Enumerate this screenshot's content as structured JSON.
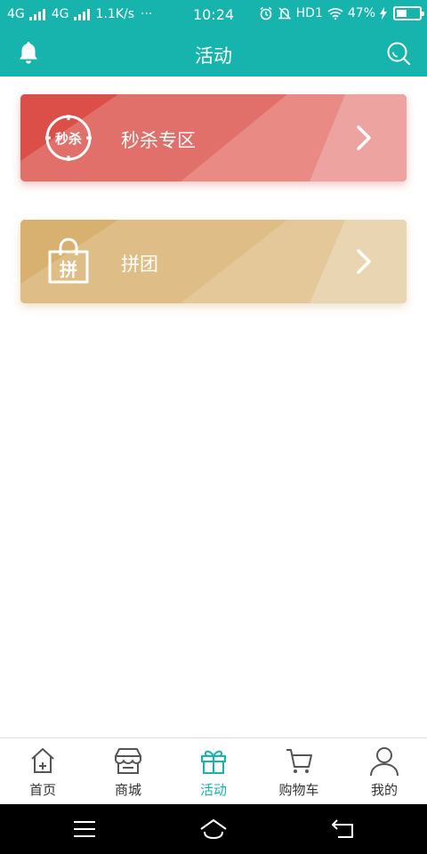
{
  "status_bar": {
    "net1": "4G",
    "net2": "4G",
    "speed": "1.1K/s",
    "more": "···",
    "time": "10:24",
    "hd": "HD1",
    "battery_percent": "47%",
    "battery_level": 0.47
  },
  "header": {
    "title": "活动",
    "left_icon": "bell-icon",
    "right_icon": "search-icon",
    "background": "#17b4ad"
  },
  "cards": [
    {
      "icon_text": "秒杀",
      "label": "秒杀专区",
      "color": "#e2706a",
      "icon": "seckill-clock-icon"
    },
    {
      "icon_text": "拼",
      "label": "拼团",
      "color": "#dfbd86",
      "icon": "shopping-bag-icon"
    }
  ],
  "tabs": [
    {
      "label": "首页",
      "icon": "home-icon",
      "active": false
    },
    {
      "label": "商城",
      "icon": "store-icon",
      "active": false
    },
    {
      "label": "活动",
      "icon": "gift-icon",
      "active": true
    },
    {
      "label": "购物车",
      "icon": "cart-icon",
      "active": false
    },
    {
      "label": "我的",
      "icon": "user-icon",
      "active": false
    }
  ],
  "accent_color": "#17b4ad",
  "system_nav": [
    "menu-icon",
    "home-outline-icon",
    "back-icon"
  ]
}
